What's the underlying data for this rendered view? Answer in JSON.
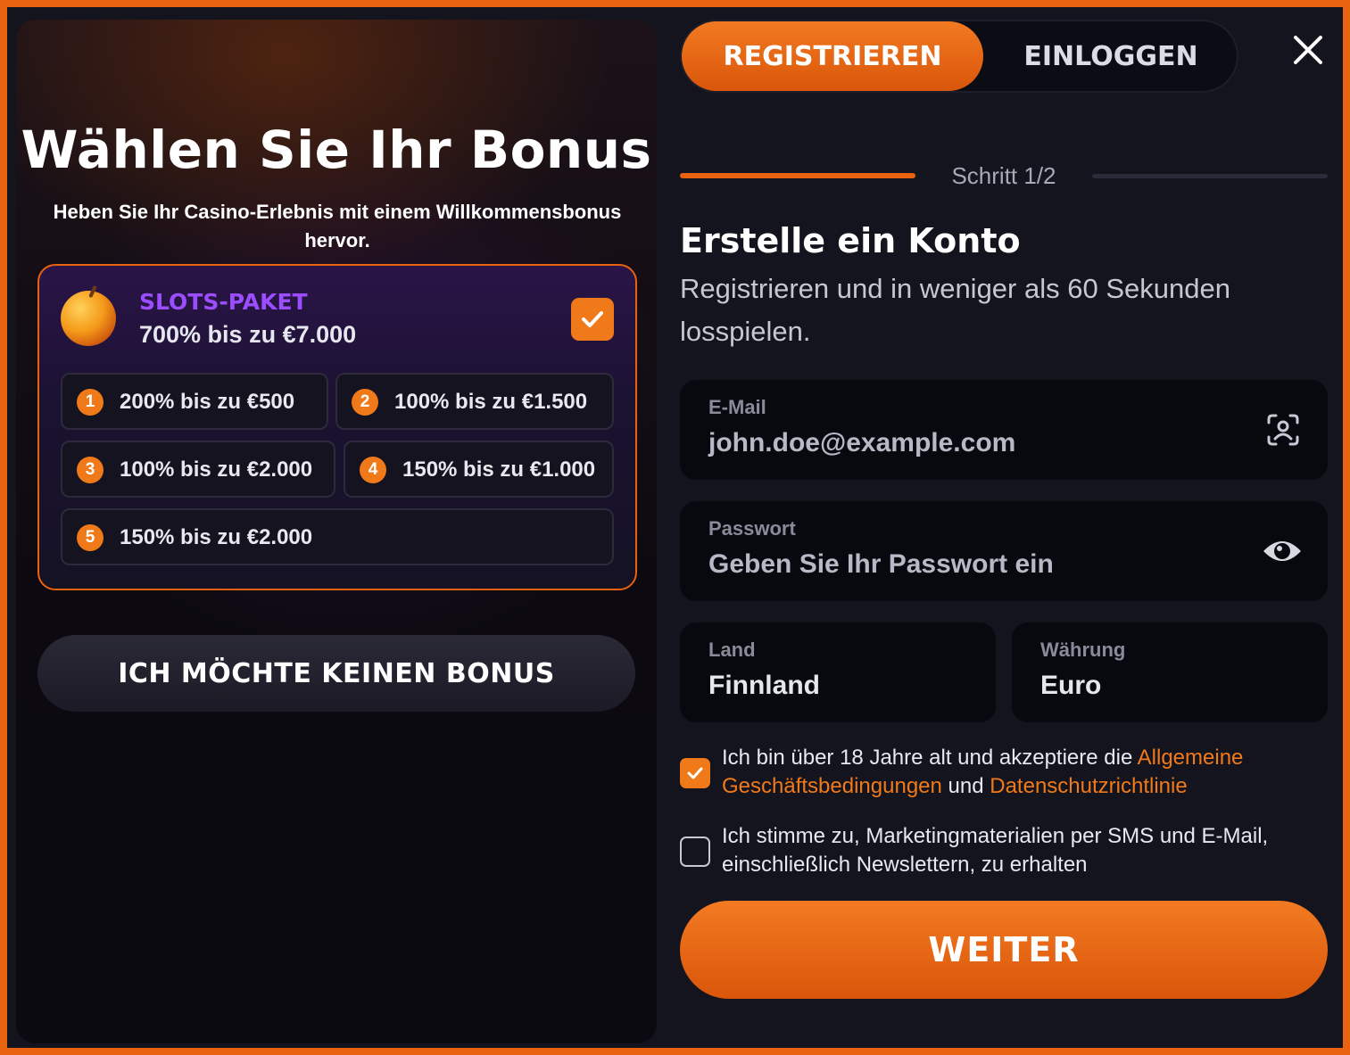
{
  "bonus_panel": {
    "title": "Wählen Sie Ihr Bonus",
    "subtitle": "Heben Sie Ihr Casino-Erlebnis mit einem Willkommensbonus hervor.",
    "package": {
      "name": "SLOTS-PAKET",
      "amount": "700% bis zu €7.000",
      "selected": true,
      "icon": "apple-icon"
    },
    "offers": [
      {
        "num": "1",
        "text": "200% bis zu €500"
      },
      {
        "num": "2",
        "text": "100% bis zu €1.500"
      },
      {
        "num": "3",
        "text": "100% bis zu €2.000"
      },
      {
        "num": "4",
        "text": "150% bis zu €1.000"
      },
      {
        "num": "5",
        "text": "150% bis zu €2.000"
      }
    ],
    "no_bonus_label": "ICH MÖCHTE KEINEN BONUS"
  },
  "tabs": {
    "register": "REGISTRIEREN",
    "login": "EINLOGGEN",
    "active": "register"
  },
  "step": {
    "text": "Schritt 1/2",
    "current": 1,
    "total": 2
  },
  "form": {
    "title": "Erstelle ein Konto",
    "subtitle": "Registrieren und in weniger als 60 Sekunden losspielen.",
    "email": {
      "label": "E-Mail",
      "placeholder": "john.doe@example.com"
    },
    "password": {
      "label": "Passwort",
      "placeholder": "Geben Sie Ihr Passwort ein"
    },
    "country": {
      "label": "Land",
      "value": "Finnland"
    },
    "currency": {
      "label": "Währung",
      "value": "Euro"
    },
    "terms": {
      "checked": true,
      "text_before": "Ich bin über 18 Jahre alt und akzeptiere die ",
      "link1": "Allgemeine Geschäftsbedingungen",
      "text_mid": " und ",
      "link2": "Datenschutzrichtlinie"
    },
    "marketing": {
      "checked": false,
      "text": "Ich stimme zu, Marketingmaterialien per SMS und E-Mail, einschließlich Newslettern, zu erhalten"
    },
    "submit_label": "WEITER"
  },
  "colors": {
    "accent": "#f07a1a",
    "package_name": "#9b4dff",
    "background": "#14141f"
  }
}
